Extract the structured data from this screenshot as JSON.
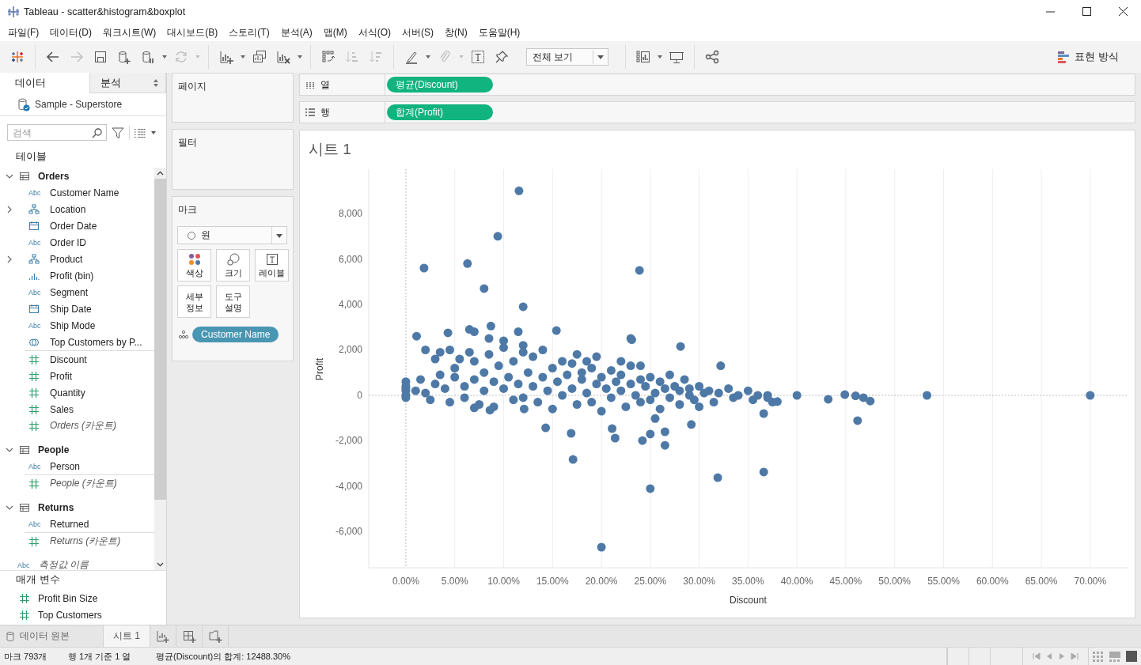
{
  "window": {
    "title": "Tableau - scatter&histogram&boxplot"
  },
  "menu": [
    "파일(F)",
    "데이터(D)",
    "워크시트(W)",
    "대시보드(B)",
    "스토리(T)",
    "분석(A)",
    "맵(M)",
    "서식(O)",
    "서버(S)",
    "창(N)",
    "도움말(H)"
  ],
  "toolbar": {
    "groups": [
      [
        {
          "kind": "logo",
          "dropdown": false
        }
      ],
      [
        {
          "kind": "back",
          "disabled": false,
          "dropdown": false
        },
        {
          "kind": "forward",
          "disabled": true,
          "dropdown": false
        },
        {
          "kind": "save",
          "disabled": false,
          "dropdown": false
        },
        {
          "kind": "new_datasource",
          "disabled": false,
          "dropdown": false
        },
        {
          "kind": "pause",
          "disabled": false,
          "dropdown": true
        },
        {
          "kind": "refresh",
          "disabled": true,
          "dropdown": true
        }
      ],
      [
        {
          "kind": "new_sheet",
          "disabled": false,
          "dropdown": true
        },
        {
          "kind": "duplicate",
          "disabled": false,
          "dropdown": false
        },
        {
          "kind": "clear",
          "disabled": false,
          "dropdown": true
        }
      ],
      [
        {
          "kind": "swap",
          "disabled": false,
          "dropdown": false
        },
        {
          "kind": "sort_asc",
          "disabled": true,
          "dropdown": false
        },
        {
          "kind": "sort_desc",
          "disabled": true,
          "dropdown": false
        }
      ],
      [
        {
          "kind": "highlight",
          "disabled": false,
          "dropdown": true
        },
        {
          "kind": "annotate",
          "disabled": true,
          "dropdown": true
        },
        {
          "kind": "labels",
          "disabled": false,
          "dropdown": false
        },
        {
          "kind": "pin",
          "disabled": false,
          "dropdown": false
        },
        {
          "kind": "fit",
          "value": "전체 보기"
        }
      ],
      [
        {
          "kind": "cards",
          "disabled": false,
          "dropdown": true
        },
        {
          "kind": "presentation",
          "disabled": false,
          "dropdown": false
        }
      ],
      [
        {
          "kind": "share",
          "disabled": false,
          "dropdown": false
        }
      ]
    ],
    "show_me": "표현 방식"
  },
  "data_panel": {
    "tabs": [
      {
        "label": "데이터",
        "selected": true
      },
      {
        "label": "분석",
        "selected": false
      }
    ],
    "datasource": "Sample - Superstore",
    "search": {
      "placeholder": "검색"
    },
    "tables_header": "테이블",
    "tables": [
      {
        "name": "Orders",
        "expanded": true,
        "children": [
          {
            "kind": "string",
            "glyph": "Abc",
            "name": "Customer Name"
          },
          {
            "kind": "hierarchy",
            "name": "Location",
            "expanded": false
          },
          {
            "kind": "date",
            "name": "Order Date"
          },
          {
            "kind": "string",
            "glyph": "Abc",
            "name": "Order ID"
          },
          {
            "kind": "hierarchy",
            "name": "Product",
            "expanded": false
          },
          {
            "kind": "bin",
            "name": "Profit (bin)"
          },
          {
            "kind": "string",
            "glyph": "Abc",
            "name": "Segment"
          },
          {
            "kind": "date",
            "name": "Ship Date"
          },
          {
            "kind": "string",
            "glyph": "Abc",
            "name": "Ship Mode"
          },
          {
            "kind": "set",
            "name": "Top Customers by P..."
          },
          {
            "kind": "measure",
            "name": "Discount"
          },
          {
            "kind": "measure",
            "name": "Profit"
          },
          {
            "kind": "measure",
            "name": "Quantity"
          },
          {
            "kind": "measure",
            "name": "Sales"
          },
          {
            "kind": "count",
            "name": "Orders (카운트)"
          }
        ]
      },
      {
        "name": "People",
        "expanded": true,
        "children": [
          {
            "kind": "string",
            "glyph": "Abc",
            "name": "Person"
          },
          {
            "kind": "count",
            "name": "People (카운트)"
          }
        ]
      },
      {
        "name": "Returns",
        "expanded": true,
        "children": [
          {
            "kind": "string",
            "glyph": "Abc",
            "name": "Returned"
          },
          {
            "kind": "count",
            "name": "Returns (카운트)"
          }
        ]
      }
    ],
    "extra_fields": [
      {
        "kind": "measure_names",
        "glyph": "Abc",
        "name": "측정값 이름"
      }
    ],
    "parameters_header": "매개 변수",
    "parameters": [
      {
        "kind": "measure",
        "name": "Profit Bin Size"
      },
      {
        "kind": "measure",
        "name": "Top Customers"
      }
    ]
  },
  "pages_card": {
    "title": "페이지"
  },
  "filters_card": {
    "title": "필터"
  },
  "marks_card": {
    "title": "마크",
    "type": "원",
    "cards": [
      {
        "kind": "color",
        "label": "색상"
      },
      {
        "kind": "size",
        "label": "크기"
      },
      {
        "kind": "label",
        "label": "레이블"
      },
      {
        "kind": "detail",
        "label": "세부\n정보"
      },
      {
        "kind": "tooltip",
        "label": "도구\n설명"
      }
    ],
    "fields": [
      {
        "kind": "detail",
        "name": "Customer Name"
      }
    ]
  },
  "columns_shelf": {
    "label": "열",
    "pills": [
      "평균(Discount)"
    ]
  },
  "rows_shelf": {
    "label": "행",
    "pills": [
      "합계(Profit)"
    ]
  },
  "sheet": {
    "title": "시트 1",
    "chart_data": {
      "type": "scatter",
      "xlabel": "Discount",
      "ylabel": "Profit",
      "grid": true,
      "xlim": [
        -0.038,
        0.739
      ],
      "ylim": [
        -7583,
        9948
      ],
      "xticks": [
        {
          "value": 0,
          "label": "0.00%"
        },
        {
          "value": 0.05,
          "label": "5.00%"
        },
        {
          "value": 0.1,
          "label": "10.00%"
        },
        {
          "value": 0.15,
          "label": "15.00%"
        },
        {
          "value": 0.2,
          "label": "20.00%"
        },
        {
          "value": 0.25,
          "label": "25.00%"
        },
        {
          "value": 0.3,
          "label": "30.00%"
        },
        {
          "value": 0.35,
          "label": "35.00%"
        },
        {
          "value": 0.4,
          "label": "40.00%"
        },
        {
          "value": 0.45,
          "label": "45.00%"
        },
        {
          "value": 0.5,
          "label": "50.00%"
        },
        {
          "value": 0.55,
          "label": "55.00%"
        },
        {
          "value": 0.6,
          "label": "60.00%"
        },
        {
          "value": 0.65,
          "label": "65.00%"
        },
        {
          "value": 0.7,
          "label": "70.00%"
        }
      ],
      "yticks": [
        {
          "value": -6000,
          "label": "-6,000"
        },
        {
          "value": -4000,
          "label": "-4,000"
        },
        {
          "value": -2000,
          "label": "-2,000"
        },
        {
          "value": 0,
          "label": "0"
        },
        {
          "value": 2000,
          "label": "2,000"
        },
        {
          "value": 4000,
          "label": "4,000"
        },
        {
          "value": 6000,
          "label": "6,000"
        },
        {
          "value": 8000,
          "label": "8,000"
        }
      ],
      "series": [
        {
          "color": "#4e79a7",
          "x": [
            0,
            0,
            0,
            0,
            0,
            0,
            0.01,
            0.015,
            0.02,
            0.025,
            0.03,
            0.035,
            0.04,
            0.045,
            0.05,
            0.05,
            0.055,
            0.06,
            0.06,
            0.065,
            0.07,
            0.07,
            0.075,
            0.08,
            0.08,
            0.085,
            0.09,
            0.09,
            0.095,
            0.1,
            0.1,
            0.105,
            0.11,
            0.11,
            0.115,
            0.12,
            0.12,
            0.125,
            0.13,
            0.13,
            0.135,
            0.14,
            0.14,
            0.145,
            0.15,
            0.15,
            0.155,
            0.16,
            0.16,
            0.165,
            0.17,
            0.17,
            0.175,
            0.18,
            0.18,
            0.185,
            0.19,
            0.19,
            0.195,
            0.2,
            0.2,
            0.205,
            0.21,
            0.21,
            0.215,
            0.22,
            0.22,
            0.225,
            0.23,
            0.23,
            0.235,
            0.24,
            0.24,
            0.245,
            0.25,
            0.25,
            0.255,
            0.26,
            0.26,
            0.265,
            0.27,
            0.27,
            0.275,
            0.28,
            0.28,
            0.285,
            0.29,
            0.29,
            0.295,
            0.3,
            0.3,
            0.305,
            0.31,
            0.315,
            0.32,
            0.33,
            0.335,
            0.34,
            0.35,
            0.355,
            0.36,
            0.37,
            0.375,
            0.065,
            0.07,
            0.085,
            0.1,
            0.115,
            0.12,
            0.035,
            0.045,
            0.03,
            0.02,
            0.175,
            0.195,
            0.22,
            0.24,
            0.185,
            0.23,
            0.1157,
            0.094,
            0.0186,
            0.063,
            0.08,
            0.239,
            0.12,
            0.011,
            0.043,
            0.087,
            0.154,
            0.231,
            0.281,
            0.322,
            0.533,
            0.7,
            0.4,
            0.432,
            0.449,
            0.46,
            0.462,
            0.468,
            0.475,
            0.366,
            0.366,
            0.319,
            0.25,
            0.2,
            0.171,
            0.169,
            0.143,
            0.211,
            0.214,
            0.242,
            0.25,
            0.265,
            0.265,
            0.292,
            0.255,
            0.07,
            0.086,
            0.121,
            0.38,
            0.37
          ],
          "values": [
            600,
            400,
            200,
            0,
            -100,
            300,
            200,
            700,
            100,
            -200,
            500,
            900,
            300,
            -300,
            800,
            1200,
            1600,
            400,
            -100,
            1900,
            700,
            1500,
            -400,
            1000,
            200,
            1800,
            600,
            -500,
            1300,
            300,
            2100,
            800,
            -200,
            1500,
            500,
            1900,
            -100,
            1000,
            400,
            1700,
            -300,
            800,
            2000,
            200,
            1200,
            -600,
            600,
            1500,
            0,
            900,
            300,
            1400,
            -400,
            700,
            1000,
            100,
            1200,
            -300,
            500,
            800,
            -700,
            300,
            1100,
            -100,
            600,
            200,
            900,
            -500,
            500,
            1300,
            0,
            700,
            -300,
            400,
            800,
            -200,
            100,
            600,
            -600,
            300,
            900,
            -100,
            400,
            200,
            -400,
            700,
            0,
            300,
            -200,
            400,
            -500,
            100,
            200,
            -300,
            100,
            300,
            -100,
            0,
            200,
            -200,
            0,
            -100,
            -300,
            2900,
            2800,
            2500,
            2400,
            2800,
            2200,
            1900,
            2000,
            1600,
            2000,
            1800,
            1700,
            1500,
            1300,
            1500,
            2500,
            9000,
            7000,
            5600,
            5800,
            4700,
            5500,
            3900,
            2600,
            2750,
            3050,
            2850,
            2450,
            2150,
            1300,
            0,
            0,
            0,
            -170,
            30,
            -20,
            -1110,
            -100,
            -250,
            -800,
            -3370,
            -3620,
            -4100,
            -6680,
            -2820,
            -1670,
            -1430,
            -1460,
            -1880,
            -1990,
            -1700,
            -1600,
            -2200,
            -1280,
            -1020,
            -550,
            -650,
            -600,
            -270,
            0
          ]
        }
      ]
    }
  },
  "sheet_tabs": [
    {
      "kind": "datasource",
      "label": "데이터 원본",
      "selected": false
    },
    {
      "kind": "sheet",
      "label": "시트 1",
      "selected": true
    }
  ],
  "status_bar": {
    "marks": "마크 793개",
    "dims": "행 1개 기준 1 열",
    "sum": "평균(Discount)의 합계: 12488.30%"
  }
}
